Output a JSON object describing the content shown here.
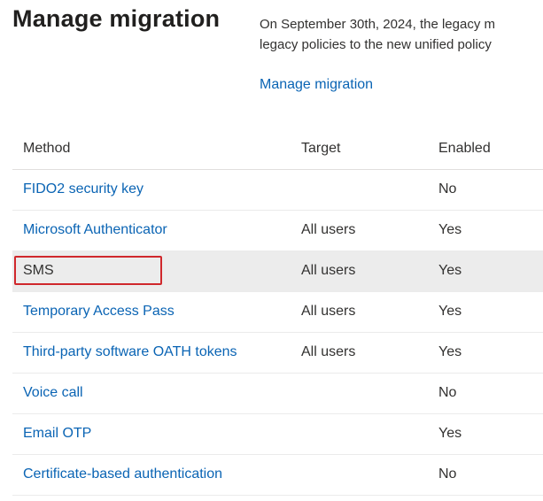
{
  "header": {
    "title": "Manage migration",
    "description_line1": "On September 30th, 2024, the legacy m",
    "description_line2": "legacy policies to the new unified policy",
    "manage_link": "Manage migration"
  },
  "table": {
    "columns": [
      "Method",
      "Target",
      "Enabled"
    ],
    "rows": [
      {
        "method": "FIDO2 security key",
        "target": "",
        "enabled": "No",
        "link": true
      },
      {
        "method": "Microsoft Authenticator",
        "target": "All users",
        "enabled": "Yes",
        "link": true
      },
      {
        "method": "SMS",
        "target": "All users",
        "enabled": "Yes",
        "link": false,
        "selected": true,
        "highlighted": true
      },
      {
        "method": "Temporary Access Pass",
        "target": "All users",
        "enabled": "Yes",
        "link": true
      },
      {
        "method": "Third-party software OATH tokens",
        "target": "All users",
        "enabled": "Yes",
        "link": true
      },
      {
        "method": "Voice call",
        "target": "",
        "enabled": "No",
        "link": true
      },
      {
        "method": "Email OTP",
        "target": "",
        "enabled": "Yes",
        "link": true
      },
      {
        "method": "Certificate-based authentication",
        "target": "",
        "enabled": "No",
        "link": true
      }
    ]
  },
  "colors": {
    "link": "#0a64b4",
    "highlight_border": "#d0282c",
    "selected_row_bg": "#ececec"
  }
}
